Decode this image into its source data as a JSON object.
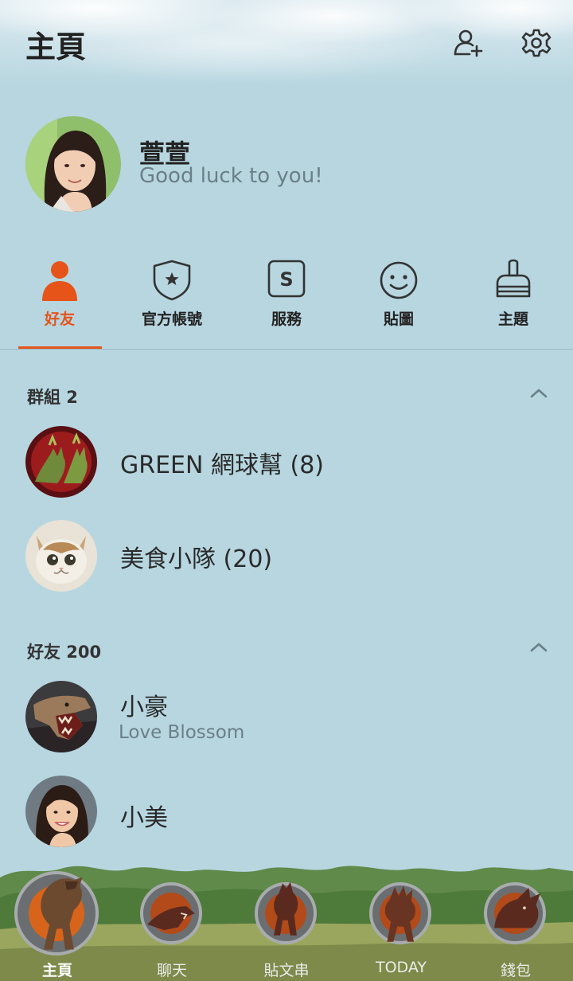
{
  "header": {
    "title": "主頁",
    "add_friend_icon": "add-user-icon",
    "settings_icon": "gear-icon"
  },
  "profile": {
    "name": "萱萱",
    "status": "Good luck to you!"
  },
  "tabs": [
    {
      "label": "好友",
      "icon": "person-icon",
      "active": true
    },
    {
      "label": "官方帳號",
      "icon": "shield-star-icon",
      "active": false
    },
    {
      "label": "服務",
      "icon": "s-square-icon",
      "active": false
    },
    {
      "label": "貼圖",
      "icon": "smiley-icon",
      "active": false
    },
    {
      "label": "主題",
      "icon": "brush-icon",
      "active": false
    }
  ],
  "groups": {
    "header": "群組 2",
    "items": [
      {
        "name": "GREEN 網球幫 (8)"
      },
      {
        "name": "美食小隊 (20)"
      }
    ]
  },
  "friends": {
    "header": "好友 200",
    "items": [
      {
        "name": "小豪",
        "status": "Love Blossom"
      },
      {
        "name": "小美",
        "status": ""
      }
    ]
  },
  "bottom_nav": [
    {
      "label": "主頁",
      "active": true
    },
    {
      "label": "聊天",
      "active": false
    },
    {
      "label": "貼文串",
      "active": false
    },
    {
      "label": "TODAY",
      "active": false
    },
    {
      "label": "錢包",
      "active": false
    }
  ],
  "colors": {
    "background": "#b7d6e0",
    "accent": "#e6541a",
    "text": "#2d2d2d",
    "muted": "#6b7f88"
  }
}
